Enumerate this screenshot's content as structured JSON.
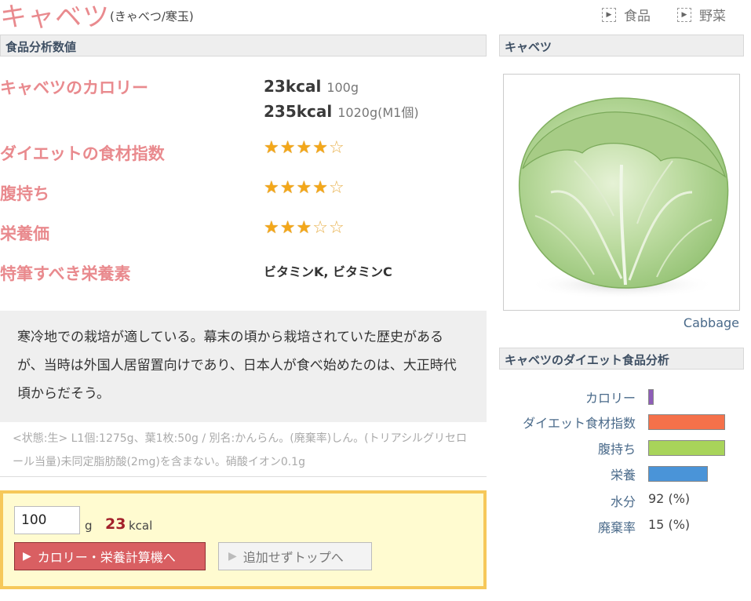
{
  "header": {
    "title": "キャベツ",
    "reading": "(きゃべつ/寒玉)",
    "breadcrumbs": [
      "食品",
      "野菜"
    ]
  },
  "analysis": {
    "heading": "食品分析数値",
    "calorie_label": "キャベツのカロリー",
    "calorie_lines": [
      {
        "kcal": "23kcal",
        "amount": "100g"
      },
      {
        "kcal": "235kcal",
        "amount": "1020g(M1個)"
      }
    ],
    "diet_label": "ダイエットの食材指数",
    "diet_stars": 4,
    "fullness_label": "腹持ち",
    "fullness_stars": 4,
    "nutrition_label": "栄養価",
    "nutrition_stars": 3,
    "max_stars": 5,
    "nutrients_label": "特筆すべき栄養素",
    "nutrients_value": "ビタミンK, ビタミンC"
  },
  "description": "寒冷地での栽培が適している。幕末の頃から栽培されていた歴史があるが、当時は外国人居留置向けであり、日本人が食べ始めたのは、大正時代頃からだそう。",
  "notes": "<状態:生> L1個:1275g、葉1枚:50g / 別名:かんらん。(廃棄率)しん。(トリアシルグリセロール当量)未同定脂肪酸(2mg)を含まない。硝酸イオン0.1g",
  "calculator": {
    "quantity": "100",
    "unit": "g",
    "kcal_value": "23",
    "kcal_unit": "kcal",
    "calc_button": "カロリー・栄養計算機へ",
    "top_button": "追加せずトップへ"
  },
  "sidebar": {
    "heading": "キャベツ",
    "caption": "Cabbage",
    "diet_heading": "キャベツのダイエット食品分析",
    "bars": [
      {
        "label": "カロリー",
        "fraction": 0.07,
        "color": "#8e5db8"
      },
      {
        "label": "ダイエット食材指数",
        "fraction": 1.0,
        "color": "#f5714a"
      },
      {
        "label": "腹持ち",
        "fraction": 1.0,
        "color": "#a8d45a"
      },
      {
        "label": "栄養",
        "fraction": 0.78,
        "color": "#4a94d8"
      }
    ],
    "water_label": "水分",
    "water_value": "92 (%)",
    "waste_label": "廃棄率",
    "waste_value": "15 (%)"
  }
}
